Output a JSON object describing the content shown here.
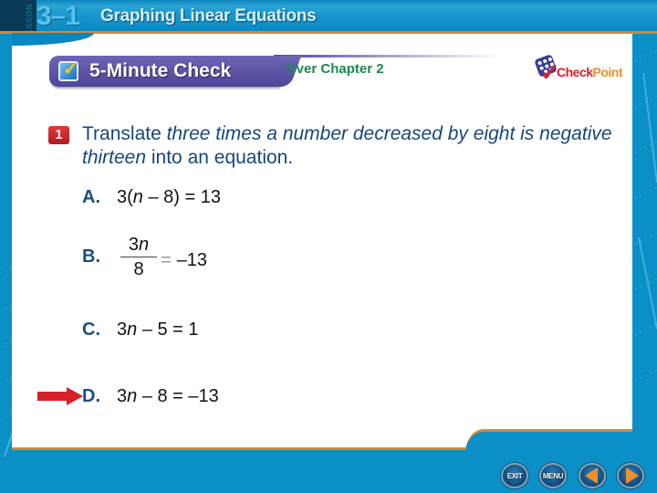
{
  "header": {
    "lesson_label": "LESSON",
    "lesson_number": "3–1",
    "lesson_title": "Graphing Linear Equations"
  },
  "badge": {
    "label": "5-Minute Check",
    "subtitle": "Over Chapter 2",
    "icon": "checkbox-icon"
  },
  "logo": {
    "check": "Check",
    "point": "Point"
  },
  "question": {
    "number": "1",
    "prefix": "Translate ",
    "italic": "three times a number decreased by eight is negative thirteen",
    "suffix": " into an equation."
  },
  "options": [
    {
      "letter": "A.",
      "parts": [
        "3(",
        "n",
        " – 8) = 13"
      ]
    },
    {
      "letter": "B.",
      "numerator_coef": "3",
      "numerator_var": "n",
      "denominator": "8",
      "equals": "=",
      "rhs": "–13"
    },
    {
      "letter": "C.",
      "parts": [
        "3",
        "n",
        " – 5 = 1"
      ]
    },
    {
      "letter": "D.",
      "parts": [
        "3",
        "n",
        " – 8 = –13"
      ]
    }
  ],
  "selected_option": "D",
  "nav": {
    "exit": "EXIT",
    "menu": "MENU",
    "prev_icon": "triangle-left-icon",
    "next_icon": "triangle-right-icon"
  },
  "colors": {
    "frame_blue": "#0a8fc7",
    "accent_orange": "#d08a3a",
    "badge_purple": "#5a52a6",
    "question_blue": "#16467e",
    "subtitle_green": "#1e8a4e",
    "arrow_red": "#d6202a"
  }
}
